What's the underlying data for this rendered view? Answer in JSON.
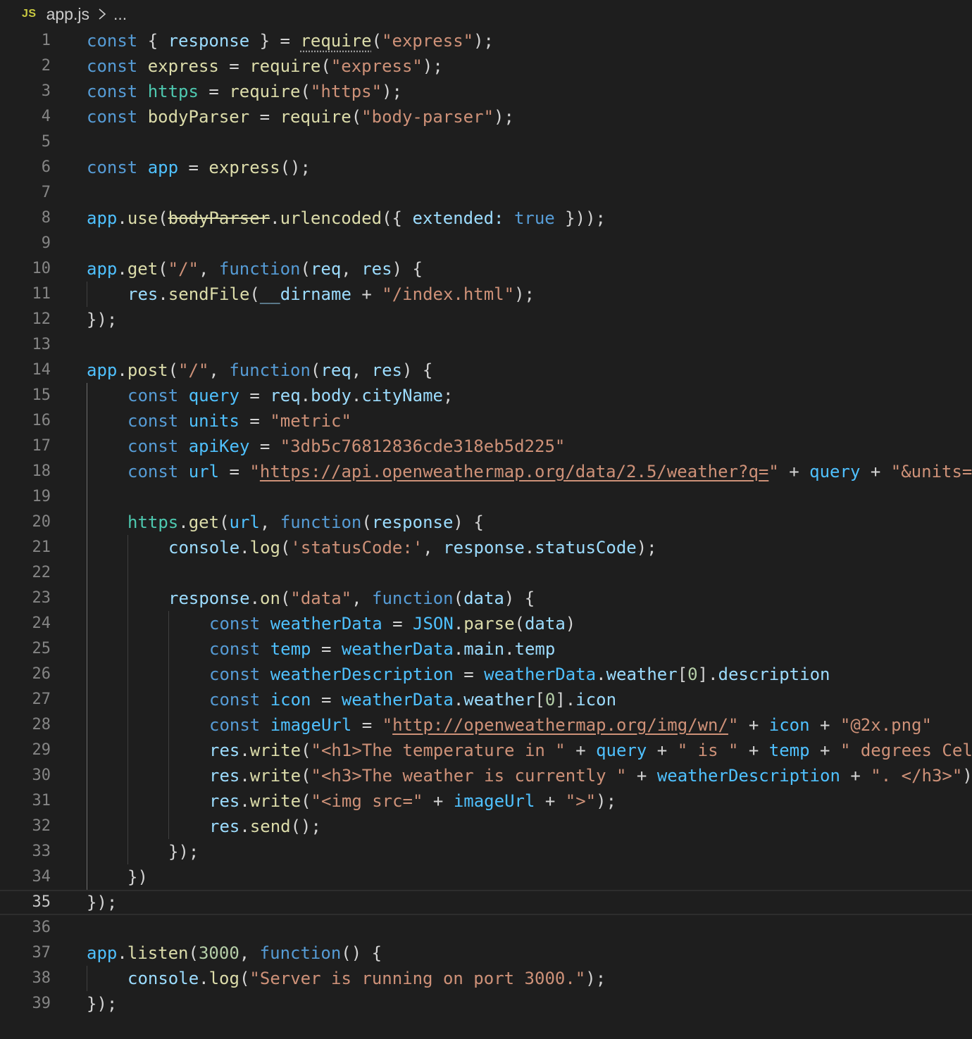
{
  "breadcrumb": {
    "lang_badge": "JS",
    "file": "app.js",
    "more": "..."
  },
  "colors": {
    "background": "#1e1e1e",
    "keyword": "#569cd6",
    "variable": "#9cdcfe",
    "constant": "#4fc1ff",
    "function": "#dcdcaa",
    "string": "#ce9178",
    "number": "#b5cea8",
    "namespace": "#4ec9b0",
    "line_number": "#858585"
  },
  "editor": {
    "current_line": 35,
    "lines": [
      {
        "n": "1",
        "indent": 0,
        "tokens": [
          [
            "k",
            "const "
          ],
          [
            "p",
            "{ "
          ],
          [
            "v",
            "response"
          ],
          [
            "p",
            " } = "
          ],
          [
            "f",
            "require"
          ],
          [
            "p",
            "("
          ],
          [
            "s",
            "\"express\""
          ],
          [
            "p",
            ");"
          ]
        ]
      },
      {
        "n": "2",
        "indent": 0,
        "tokens": [
          [
            "k",
            "const "
          ],
          [
            "f",
            "express"
          ],
          [
            "p",
            " = "
          ],
          [
            "f",
            "require"
          ],
          [
            "p",
            "("
          ],
          [
            "s",
            "\"express\""
          ],
          [
            "p",
            ");"
          ]
        ]
      },
      {
        "n": "3",
        "indent": 0,
        "tokens": [
          [
            "k",
            "const "
          ],
          [
            "t",
            "https"
          ],
          [
            "p",
            " = "
          ],
          [
            "f",
            "require"
          ],
          [
            "p",
            "("
          ],
          [
            "s",
            "\"https\""
          ],
          [
            "p",
            ");"
          ]
        ]
      },
      {
        "n": "4",
        "indent": 0,
        "tokens": [
          [
            "k",
            "const "
          ],
          [
            "f",
            "bodyParser"
          ],
          [
            "p",
            " = "
          ],
          [
            "f",
            "require"
          ],
          [
            "p",
            "("
          ],
          [
            "s",
            "\"body-parser\""
          ],
          [
            "p",
            ");"
          ]
        ]
      },
      {
        "n": "5",
        "indent": 0,
        "tokens": []
      },
      {
        "n": "6",
        "indent": 0,
        "tokens": [
          [
            "k",
            "const "
          ],
          [
            "c",
            "app"
          ],
          [
            "p",
            " = "
          ],
          [
            "f",
            "express"
          ],
          [
            "p",
            "();"
          ]
        ]
      },
      {
        "n": "7",
        "indent": 0,
        "tokens": []
      },
      {
        "n": "8",
        "indent": 0,
        "tokens": [
          [
            "c",
            "app"
          ],
          [
            "p",
            "."
          ],
          [
            "f",
            "use"
          ],
          [
            "p",
            "("
          ],
          [
            "f strike",
            "bodyParser"
          ],
          [
            "p",
            "."
          ],
          [
            "f",
            "urlencoded"
          ],
          [
            "p",
            "({ "
          ],
          [
            "v",
            "extended"
          ],
          [
            "v",
            ":"
          ],
          [
            "p",
            " "
          ],
          [
            "k",
            "true"
          ],
          [
            "p",
            " }));"
          ]
        ]
      },
      {
        "n": "9",
        "indent": 0,
        "tokens": []
      },
      {
        "n": "10",
        "indent": 0,
        "tokens": [
          [
            "c",
            "app"
          ],
          [
            "p",
            "."
          ],
          [
            "f",
            "get"
          ],
          [
            "p",
            "("
          ],
          [
            "s",
            "\"/\""
          ],
          [
            "p",
            ", "
          ],
          [
            "k",
            "function"
          ],
          [
            "p",
            "("
          ],
          [
            "v",
            "req"
          ],
          [
            "p",
            ", "
          ],
          [
            "v",
            "res"
          ],
          [
            "p",
            ") {"
          ]
        ]
      },
      {
        "n": "11",
        "indent": 1,
        "tokens": [
          [
            "v",
            "res"
          ],
          [
            "p",
            "."
          ],
          [
            "f",
            "sendFile"
          ],
          [
            "p",
            "("
          ],
          [
            "v",
            "__dirname"
          ],
          [
            "p",
            " + "
          ],
          [
            "s",
            "\"/index.html\""
          ],
          [
            "p",
            ");"
          ]
        ]
      },
      {
        "n": "12",
        "indent": 0,
        "tokens": [
          [
            "p",
            "});"
          ]
        ]
      },
      {
        "n": "13",
        "indent": 0,
        "tokens": []
      },
      {
        "n": "14",
        "indent": 0,
        "tokens": [
          [
            "c",
            "app"
          ],
          [
            "p",
            "."
          ],
          [
            "f",
            "post"
          ],
          [
            "p",
            "("
          ],
          [
            "s",
            "\"/\""
          ],
          [
            "p",
            ", "
          ],
          [
            "k",
            "function"
          ],
          [
            "p",
            "("
          ],
          [
            "v",
            "req"
          ],
          [
            "p",
            ", "
          ],
          [
            "v",
            "res"
          ],
          [
            "p",
            ") {"
          ]
        ]
      },
      {
        "n": "15",
        "indent": 1,
        "tokens": [
          [
            "k",
            "const "
          ],
          [
            "c",
            "query"
          ],
          [
            "p",
            " = "
          ],
          [
            "v",
            "req"
          ],
          [
            "p",
            "."
          ],
          [
            "v",
            "body"
          ],
          [
            "p",
            "."
          ],
          [
            "v",
            "cityName"
          ],
          [
            "p",
            ";"
          ]
        ]
      },
      {
        "n": "16",
        "indent": 1,
        "tokens": [
          [
            "k",
            "const "
          ],
          [
            "c",
            "units"
          ],
          [
            "p",
            " = "
          ],
          [
            "s",
            "\"metric\""
          ]
        ]
      },
      {
        "n": "17",
        "indent": 1,
        "tokens": [
          [
            "k",
            "const "
          ],
          [
            "c",
            "apiKey"
          ],
          [
            "p",
            " = "
          ],
          [
            "s",
            "\"3db5c76812836cde318eb5d225\""
          ]
        ]
      },
      {
        "n": "18",
        "indent": 1,
        "tokens": [
          [
            "k",
            "const "
          ],
          [
            "c",
            "url"
          ],
          [
            "p",
            " = "
          ],
          [
            "s",
            "\""
          ],
          [
            "s u",
            "https://api.openweathermap.org/data/2.5/weather?q="
          ],
          [
            "s",
            "\""
          ],
          [
            "p",
            " + "
          ],
          [
            "c",
            "query"
          ],
          [
            "p",
            " + "
          ],
          [
            "s",
            "\"&units="
          ]
        ]
      },
      {
        "n": "19",
        "indent": 1,
        "tokens": []
      },
      {
        "n": "20",
        "indent": 1,
        "tokens": [
          [
            "t",
            "https"
          ],
          [
            "p",
            "."
          ],
          [
            "f",
            "get"
          ],
          [
            "p",
            "("
          ],
          [
            "c",
            "url"
          ],
          [
            "p",
            ", "
          ],
          [
            "k",
            "function"
          ],
          [
            "p",
            "("
          ],
          [
            "v",
            "response"
          ],
          [
            "p",
            ") {"
          ]
        ]
      },
      {
        "n": "21",
        "indent": 2,
        "tokens": [
          [
            "v",
            "console"
          ],
          [
            "p",
            "."
          ],
          [
            "f",
            "log"
          ],
          [
            "p",
            "("
          ],
          [
            "s",
            "'statusCode:'"
          ],
          [
            "p",
            ", "
          ],
          [
            "v",
            "response"
          ],
          [
            "p",
            "."
          ],
          [
            "v",
            "statusCode"
          ],
          [
            "p",
            ");"
          ]
        ]
      },
      {
        "n": "22",
        "indent": 2,
        "tokens": []
      },
      {
        "n": "23",
        "indent": 2,
        "tokens": [
          [
            "v",
            "response"
          ],
          [
            "p",
            "."
          ],
          [
            "f",
            "on"
          ],
          [
            "p",
            "("
          ],
          [
            "s",
            "\"data\""
          ],
          [
            "p",
            ", "
          ],
          [
            "k",
            "function"
          ],
          [
            "p",
            "("
          ],
          [
            "v",
            "data"
          ],
          [
            "p",
            ") {"
          ]
        ]
      },
      {
        "n": "24",
        "indent": 3,
        "tokens": [
          [
            "k",
            "const "
          ],
          [
            "c",
            "weatherData"
          ],
          [
            "p",
            " = "
          ],
          [
            "c",
            "JSON"
          ],
          [
            "p",
            "."
          ],
          [
            "f",
            "parse"
          ],
          [
            "p",
            "("
          ],
          [
            "v",
            "data"
          ],
          [
            "p",
            ")"
          ]
        ]
      },
      {
        "n": "25",
        "indent": 3,
        "tokens": [
          [
            "k",
            "const "
          ],
          [
            "c",
            "temp"
          ],
          [
            "p",
            " = "
          ],
          [
            "c",
            "weatherData"
          ],
          [
            "p",
            "."
          ],
          [
            "v",
            "main"
          ],
          [
            "p",
            "."
          ],
          [
            "v",
            "temp"
          ]
        ]
      },
      {
        "n": "26",
        "indent": 3,
        "tokens": [
          [
            "k",
            "const "
          ],
          [
            "c",
            "weatherDescription"
          ],
          [
            "p",
            " = "
          ],
          [
            "c",
            "weatherData"
          ],
          [
            "p",
            "."
          ],
          [
            "v",
            "weather"
          ],
          [
            "p",
            "["
          ],
          [
            "n",
            "0"
          ],
          [
            "p",
            "]."
          ],
          [
            "v",
            "description"
          ]
        ]
      },
      {
        "n": "27",
        "indent": 3,
        "tokens": [
          [
            "k",
            "const "
          ],
          [
            "c",
            "icon"
          ],
          [
            "p",
            " = "
          ],
          [
            "c",
            "weatherData"
          ],
          [
            "p",
            "."
          ],
          [
            "v",
            "weather"
          ],
          [
            "p",
            "["
          ],
          [
            "n",
            "0"
          ],
          [
            "p",
            "]."
          ],
          [
            "v",
            "icon"
          ]
        ]
      },
      {
        "n": "28",
        "indent": 3,
        "tokens": [
          [
            "k",
            "const "
          ],
          [
            "c",
            "imageUrl"
          ],
          [
            "p",
            " = "
          ],
          [
            "s",
            "\""
          ],
          [
            "s u",
            "http://openweathermap.org/img/wn/"
          ],
          [
            "s",
            "\""
          ],
          [
            "p",
            " + "
          ],
          [
            "c",
            "icon"
          ],
          [
            "p",
            " + "
          ],
          [
            "s",
            "\"@2x.png\""
          ]
        ]
      },
      {
        "n": "29",
        "indent": 3,
        "tokens": [
          [
            "v",
            "res"
          ],
          [
            "p",
            "."
          ],
          [
            "f",
            "write"
          ],
          [
            "p",
            "("
          ],
          [
            "s",
            "\"<h1>The temperature in \""
          ],
          [
            "p",
            " + "
          ],
          [
            "c",
            "query"
          ],
          [
            "p",
            " + "
          ],
          [
            "s",
            "\" is \""
          ],
          [
            "p",
            " + "
          ],
          [
            "c",
            "temp"
          ],
          [
            "p",
            " + "
          ],
          [
            "s",
            "\" degrees Cel"
          ]
        ]
      },
      {
        "n": "30",
        "indent": 3,
        "tokens": [
          [
            "v",
            "res"
          ],
          [
            "p",
            "."
          ],
          [
            "f",
            "write"
          ],
          [
            "p",
            "("
          ],
          [
            "s",
            "\"<h3>The weather is currently \""
          ],
          [
            "p",
            " + "
          ],
          [
            "c",
            "weatherDescription"
          ],
          [
            "p",
            " + "
          ],
          [
            "s",
            "\". </h3>\""
          ],
          [
            "p",
            ")"
          ]
        ]
      },
      {
        "n": "31",
        "indent": 3,
        "tokens": [
          [
            "v",
            "res"
          ],
          [
            "p",
            "."
          ],
          [
            "f",
            "write"
          ],
          [
            "p",
            "("
          ],
          [
            "s",
            "\"<img src=\""
          ],
          [
            "p",
            " + "
          ],
          [
            "c",
            "imageUrl"
          ],
          [
            "p",
            " + "
          ],
          [
            "s",
            "\">\""
          ],
          [
            "p",
            ");"
          ]
        ]
      },
      {
        "n": "32",
        "indent": 3,
        "tokens": [
          [
            "v",
            "res"
          ],
          [
            "p",
            "."
          ],
          [
            "f",
            "send"
          ],
          [
            "p",
            "();"
          ]
        ]
      },
      {
        "n": "33",
        "indent": 2,
        "tokens": [
          [
            "p",
            "});"
          ]
        ]
      },
      {
        "n": "34",
        "indent": 1,
        "tokens": [
          [
            "p",
            "})"
          ]
        ]
      },
      {
        "n": "35",
        "indent": 0,
        "tokens": [
          [
            "p",
            "});"
          ]
        ]
      },
      {
        "n": "36",
        "indent": 0,
        "tokens": []
      },
      {
        "n": "37",
        "indent": 0,
        "tokens": [
          [
            "c",
            "app"
          ],
          [
            "p",
            "."
          ],
          [
            "f",
            "listen"
          ],
          [
            "p",
            "("
          ],
          [
            "n",
            "3000"
          ],
          [
            "p",
            ", "
          ],
          [
            "k",
            "function"
          ],
          [
            "p",
            "() {"
          ]
        ]
      },
      {
        "n": "38",
        "indent": 1,
        "tokens": [
          [
            "v",
            "console"
          ],
          [
            "p",
            "."
          ],
          [
            "f",
            "log"
          ],
          [
            "p",
            "("
          ],
          [
            "s",
            "\"Server is running on port 3000.\""
          ],
          [
            "p",
            ");"
          ]
        ]
      },
      {
        "n": "39",
        "indent": 0,
        "tokens": [
          [
            "p",
            "});"
          ]
        ]
      }
    ]
  }
}
